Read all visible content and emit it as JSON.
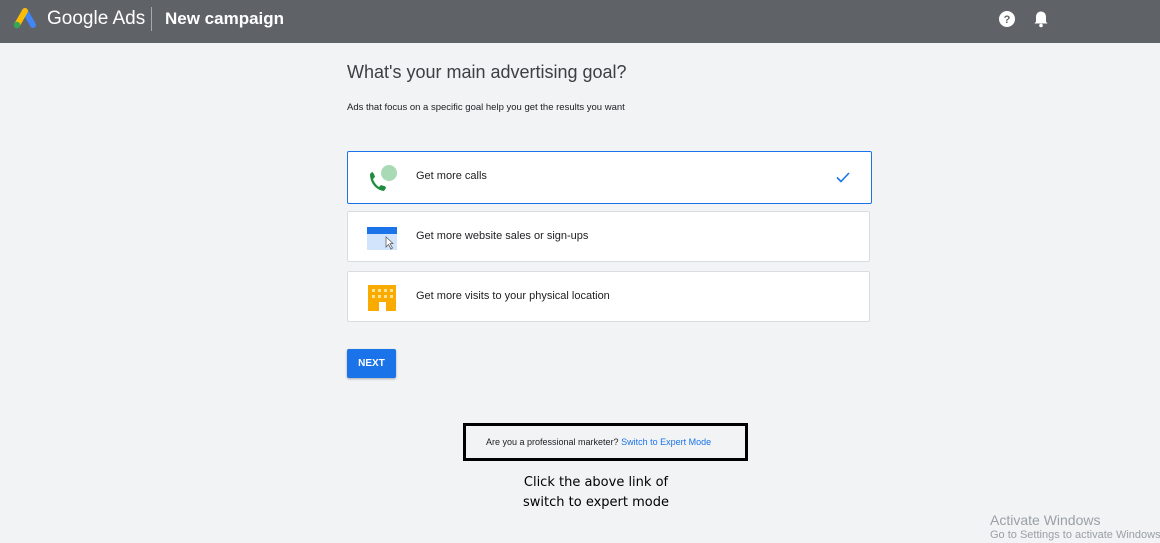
{
  "header": {
    "brand": "Google Ads",
    "page_title": "New campaign",
    "icons": [
      "help-icon",
      "bell-icon"
    ]
  },
  "main": {
    "heading": "What's your main advertising goal?",
    "subheading": "Ads that focus on a specific goal help you get the results you want",
    "options": [
      {
        "label": "Get more calls",
        "icon": "phone-call-icon",
        "selected": true
      },
      {
        "label": "Get more website sales or sign-ups",
        "icon": "website-icon",
        "selected": false
      },
      {
        "label": "Get more visits to your physical location",
        "icon": "storefront-icon",
        "selected": false
      }
    ],
    "next_label": "NEXT"
  },
  "expert": {
    "prompt": "Are you a professional marketer? ",
    "link": "Switch to Expert Mode"
  },
  "annotation": {
    "line1": "Click the above link of",
    "line2": "switch to expert mode"
  },
  "watermark": {
    "line1": "Activate Windows",
    "line2": "Go to Settings to activate Windows."
  },
  "colors": {
    "accent": "#1a73e8",
    "topbar": "#5f6368",
    "background": "#f1f3f4"
  }
}
